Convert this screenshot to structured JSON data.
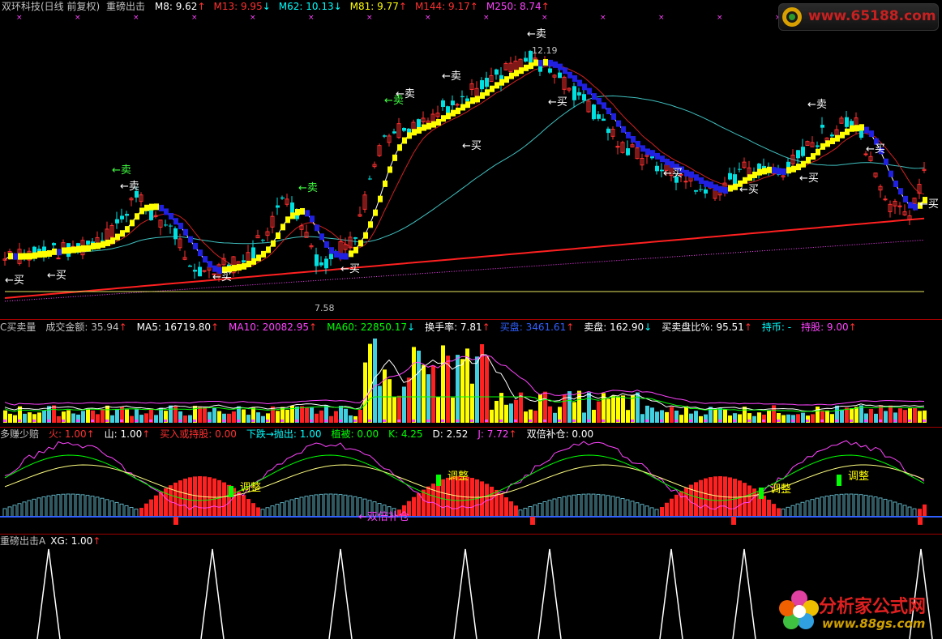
{
  "main_header": {
    "stock": "双环科技(日线 前复权)",
    "indicator": "重磅出击",
    "items": [
      {
        "label": "M8: 9.62",
        "color": "#ffffff",
        "arrow": "↑",
        "acolor": "#ff3030"
      },
      {
        "label": "M13: 9.95",
        "color": "#ff3030",
        "arrow": "↓",
        "acolor": "#00ffff"
      },
      {
        "label": "M62: 10.13",
        "color": "#00ffff",
        "arrow": "↓",
        "acolor": "#00ffff"
      },
      {
        "label": "M81: 9.77",
        "color": "#ffff00",
        "arrow": "↑",
        "acolor": "#ff3030"
      },
      {
        "label": "M144: 9.17",
        "color": "#ff3030",
        "arrow": "↑",
        "acolor": "#ff3030"
      },
      {
        "label": "M250: 8.74",
        "color": "#ff44ff",
        "arrow": "↑",
        "acolor": "#ff3030"
      }
    ]
  },
  "main_chart": {
    "price_high": "12.19",
    "price_low": "7.58",
    "sell_label": "←卖",
    "buy_label": "←买",
    "buy_label_right": "买",
    "buy_label_left": "买"
  },
  "volume_header": {
    "items": [
      {
        "label": "C买卖量",
        "color": "#c0c0c0"
      },
      {
        "label": "成交金额: 35.94",
        "color": "#c0c0c0",
        "arrow": "↑",
        "acolor": "#ff3030"
      },
      {
        "label": "MA5: 16719.80",
        "color": "#ffffff",
        "arrow": "↑",
        "acolor": "#ff3030"
      },
      {
        "label": "MA10: 20082.95",
        "color": "#ff44ff",
        "arrow": "↑",
        "acolor": "#ff3030"
      },
      {
        "label": "MA60: 22850.17",
        "color": "#00ff00",
        "arrow": "↓",
        "acolor": "#00ffff"
      },
      {
        "label": "换手率: 7.81",
        "color": "#ffffff",
        "arrow": "↑",
        "acolor": "#ff3030"
      },
      {
        "label": "买盘: 3461.61",
        "color": "#3060ff",
        "arrow": "↑",
        "acolor": "#ff3030"
      },
      {
        "label": "卖盘: 162.90",
        "color": "#ffffff",
        "arrow": "↓",
        "acolor": "#00ffff"
      },
      {
        "label": "买卖盘比%: 95.51",
        "color": "#ffffff",
        "arrow": "↑",
        "acolor": "#ff3030"
      },
      {
        "label": "持币: -",
        "color": "#00ffff"
      },
      {
        "label": "持股: 9.00",
        "color": "#ff44ff",
        "arrow": "↑",
        "acolor": "#ff3030"
      }
    ]
  },
  "osc_header": {
    "items": [
      {
        "label": "多赚少赔",
        "color": "#c0c0c0"
      },
      {
        "label": "火: 1.00",
        "color": "#ff3030",
        "arrow": "↑",
        "acolor": "#ff3030"
      },
      {
        "label": "山: 1.00",
        "color": "#ffffff",
        "arrow": "↑",
        "acolor": "#ff3030"
      },
      {
        "label": "买入或持股: 0.00",
        "color": "#ff3030"
      },
      {
        "label": "下跌→抛出: 1.00",
        "color": "#00ffff"
      },
      {
        "label": "植被: 0.00",
        "color": "#00ff00"
      },
      {
        "label": "K: 4.25",
        "color": "#00ff00"
      },
      {
        "label": "D: 2.52",
        "color": "#ffffff"
      },
      {
        "label": "J: 7.72",
        "color": "#ff44ff",
        "arrow": "↑",
        "acolor": "#ff3030"
      },
      {
        "label": "双倍补仓: 0.00",
        "color": "#ffffff"
      }
    ],
    "adjust_label": "调整",
    "double_label": "←双倍补仓"
  },
  "signal_header": {
    "items": [
      {
        "label": "重磅出击A",
        "color": "#c0c0c0"
      },
      {
        "label": "XG: 1.00",
        "color": "#ffffff",
        "arrow": "↑",
        "acolor": "#ff3030"
      }
    ]
  },
  "watermarks": {
    "top": "www.65188.com",
    "bottom_cn": "分析家公式网",
    "bottom_url": "www.88gs.com"
  }
}
